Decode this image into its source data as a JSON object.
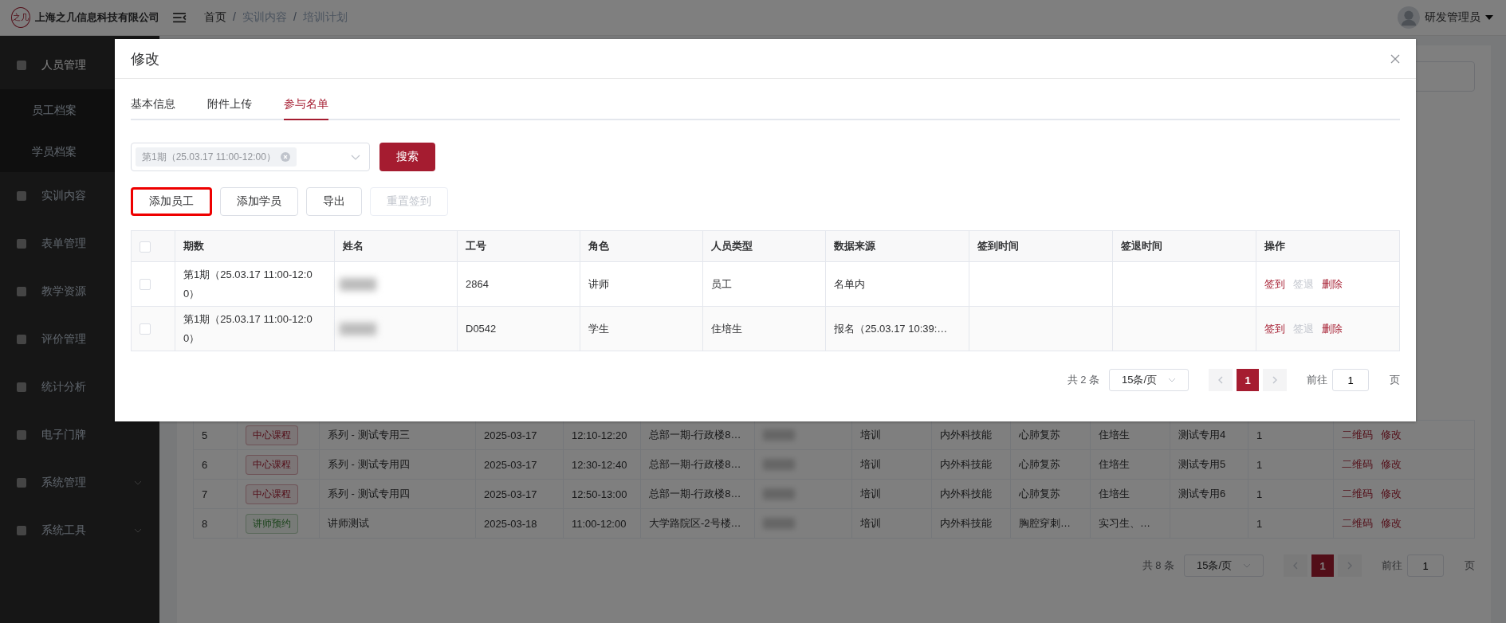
{
  "header": {
    "logo_text": "之几",
    "company": "上海之几信息科技有限公司",
    "breadcrumb": [
      "首页",
      "实训内容",
      "培训计划"
    ],
    "breadcrumb_separator": "/",
    "user": "研发管理员"
  },
  "sidebar": {
    "items": [
      {
        "label": "人员管理",
        "kind": "group",
        "expanded": true,
        "children": [
          {
            "label": "员工档案"
          },
          {
            "label": "学员档案"
          }
        ]
      },
      {
        "label": "实训内容",
        "kind": "link"
      },
      {
        "label": "表单管理",
        "kind": "link"
      },
      {
        "label": "教学资源",
        "kind": "link"
      },
      {
        "label": "评价管理",
        "kind": "link"
      },
      {
        "label": "统计分析",
        "kind": "link"
      },
      {
        "label": "电子门牌",
        "kind": "link"
      },
      {
        "label": "系统管理",
        "kind": "group",
        "expanded": false
      },
      {
        "label": "系统工具",
        "kind": "group",
        "expanded": false
      }
    ]
  },
  "background_table": {
    "rows": [
      {
        "no": "5",
        "tag": {
          "text": "中心课程",
          "kind": "center"
        },
        "name": "系列 - 测试专用三",
        "date": "2025-03-17",
        "time": "12:10-12:20",
        "location": "总部一期-行政楼8…",
        "type": "培训",
        "category": "内外科技能",
        "skill": "心肺复苏",
        "audience": "住培生",
        "remark": "测试专用4",
        "count": "1",
        "actions": [
          "二维码",
          "修改"
        ]
      },
      {
        "no": "6",
        "tag": {
          "text": "中心课程",
          "kind": "center"
        },
        "name": "系列 - 测试专用四",
        "date": "2025-03-17",
        "time": "12:30-12:40",
        "location": "总部一期-行政楼8…",
        "type": "培训",
        "category": "内外科技能",
        "skill": "心肺复苏",
        "audience": "住培生",
        "remark": "测试专用5",
        "count": "1",
        "actions": [
          "二维码",
          "修改"
        ]
      },
      {
        "no": "7",
        "tag": {
          "text": "中心课程",
          "kind": "center"
        },
        "name": "系列 - 测试专用四",
        "date": "2025-03-17",
        "time": "12:50-13:00",
        "location": "总部一期-行政楼8…",
        "type": "培训",
        "category": "内外科技能",
        "skill": "心肺复苏",
        "audience": "住培生",
        "remark": "测试专用6",
        "count": "1",
        "actions": [
          "二维码",
          "修改"
        ]
      },
      {
        "no": "8",
        "tag": {
          "text": "讲师预约",
          "kind": "lecturer"
        },
        "name": "讲师测试",
        "date": "2025-03-18",
        "time": "11:00-12:00",
        "location": "大学路院区-2号楼…",
        "type": "培训",
        "category": "内外科技能",
        "skill": "胸腔穿刺…",
        "audience": "实习生、…",
        "remark": "",
        "count": "1",
        "actions": [
          "二维码",
          "修改"
        ]
      }
    ],
    "pagination": {
      "total": "共 8 条",
      "page_size": "15条/页",
      "pages": [
        {
          "label": "1",
          "selected": true
        }
      ],
      "goto_label": "前往",
      "goto_value": "1",
      "page_unit": "页"
    }
  },
  "modal": {
    "title": "修改",
    "tabs": [
      {
        "label": "基本信息",
        "selected": false
      },
      {
        "label": "附件上传",
        "selected": false
      },
      {
        "label": "参与名单",
        "selected": true
      }
    ],
    "period_select": {
      "chip": "第1期（25.03.17 11:00-12:00）"
    },
    "search_button": "搜索",
    "buttons": [
      {
        "label": "添加员工",
        "disabled": false,
        "highlighted": true
      },
      {
        "label": "添加学员",
        "disabled": false,
        "highlighted": false
      },
      {
        "label": "导出",
        "disabled": false,
        "highlighted": false
      },
      {
        "label": "重置签到",
        "disabled": true,
        "highlighted": false
      }
    ],
    "table": {
      "select_all_checked": false,
      "columns": [
        "期数",
        "姓名",
        "工号",
        "角色",
        "人员类型",
        "数据来源",
        "签到时间",
        "签退时间",
        "操作"
      ],
      "rows": [
        {
          "checked": false,
          "period": "第1期（25.03.17 11:00-12:00）",
          "staff_no": "2864",
          "role": "讲师",
          "person_type": "员工",
          "source": "名单内",
          "check_in": "",
          "check_out": "",
          "actions": [
            {
              "label": "签到",
              "disabled": false
            },
            {
              "label": "签退",
              "disabled": true
            },
            {
              "label": "删除",
              "disabled": false
            }
          ]
        },
        {
          "checked": false,
          "period": "第1期（25.03.17 11:00-12:00）",
          "staff_no": "D0542",
          "role": "学生",
          "person_type": "住培生",
          "source": "报名（25.03.17 10:39:…",
          "check_in": "",
          "check_out": "",
          "actions": [
            {
              "label": "签到",
              "disabled": false
            },
            {
              "label": "签退",
              "disabled": true
            },
            {
              "label": "删除",
              "disabled": false
            }
          ]
        }
      ]
    },
    "pagination": {
      "total": "共 2 条",
      "page_size": "15条/页",
      "pages": [
        {
          "label": "1",
          "selected": true
        }
      ],
      "goto_label": "前往",
      "goto_value": "1",
      "page_unit": "页"
    }
  }
}
